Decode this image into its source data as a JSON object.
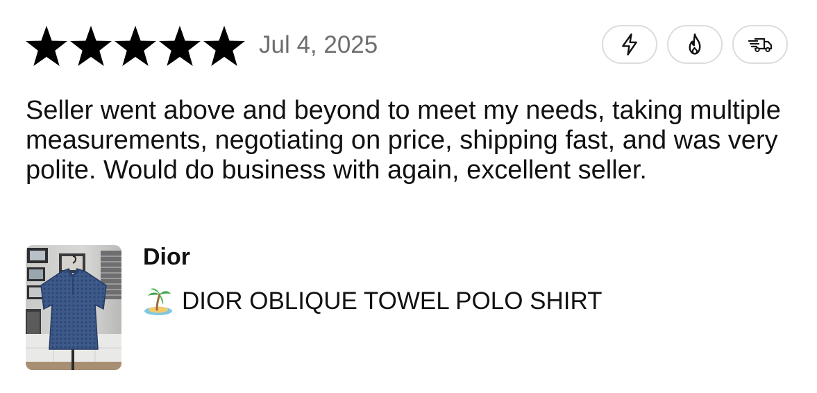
{
  "review": {
    "rating": 5,
    "rating_max": 5,
    "date": "Jul 4, 2025",
    "badges": [
      {
        "icon": "lightning-icon"
      },
      {
        "icon": "flame-icon"
      },
      {
        "icon": "fast-shipping-truck-icon"
      }
    ],
    "text": "Seller went above and beyond to meet my needs, taking multiple measurements, negotiating on price, shipping fast, and was very polite. Would do business with again, excellent seller."
  },
  "item": {
    "brand": "Dior",
    "emoji": "desert-island-icon",
    "title": "DIOR OBLIQUE TOWEL POLO SHIRT",
    "thumbnail": "product-photo-blue-polo-shirt-on-hanger"
  },
  "colors": {
    "star": "#000000",
    "date": "#6e6e6e",
    "badge_border": "#dcdcdc",
    "text": "#111111"
  }
}
